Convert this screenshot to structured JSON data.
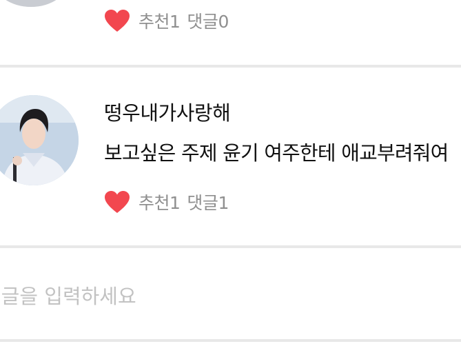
{
  "comments": [
    {
      "likes_label": "추천",
      "likes_count": "1",
      "replies_label": "댓글",
      "replies_count": "0"
    },
    {
      "username": "떵우내가사랑해",
      "text": "보고싶은 주제 윤기 여주한테 애교부려줘여",
      "likes_label": "추천",
      "likes_count": "1",
      "replies_label": "댓글",
      "replies_count": "1"
    }
  ],
  "input": {
    "placeholder": "댓글을 입력하세요"
  },
  "colors": {
    "heart": "#f2474f",
    "meta_text": "#8f8f8f",
    "divider": "#e8e8e8",
    "placeholder": "#c2c2c2"
  }
}
